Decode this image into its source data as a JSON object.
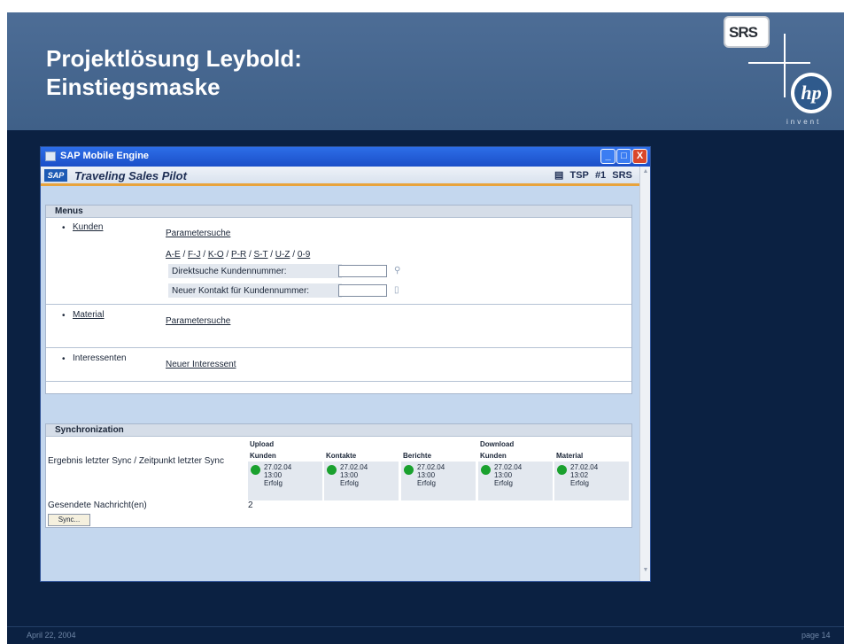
{
  "slide": {
    "title": "Projektlösung Leybold:\nEinstiegsmaske",
    "footer_date": "April 22, 2004",
    "footer_page": "page 14",
    "logo_srs": "SRS",
    "logo_hp": "hp",
    "logo_invent": "invent"
  },
  "window": {
    "title": "SAP Mobile Engine",
    "app_title": "Traveling Sales Pilot",
    "sap_logo": "SAP",
    "right_marker": "#1",
    "tsp_label": "TSP",
    "srs_label": "SRS",
    "controls": {
      "minimize": "_",
      "maximize": "□",
      "close": "X"
    }
  },
  "menus": {
    "heading": "Menus",
    "kunden": {
      "label": "Kunden",
      "parametersuche": "Parametersuche",
      "ranges": [
        "A-E",
        "F-J",
        "K-O",
        "P-R",
        "S-T",
        "U-Z",
        "0-9"
      ],
      "direktsuche_label": "Direktsuche Kundennummer:",
      "neuer_kontakt_label": "Neuer Kontakt für Kundennummer:"
    },
    "material": {
      "label": "Material",
      "parametersuche": "Parametersuche"
    },
    "interessenten": {
      "label": "Interessenten",
      "neuer": "Neuer Interessent"
    }
  },
  "sync": {
    "heading": "Synchronization",
    "upload_label": "Upload",
    "download_label": "Download",
    "row_label": "Ergebnis letzter Sync / Zeitpunkt letzter Sync",
    "columns": [
      {
        "name": "Kunden",
        "date": "27.02.04",
        "time": "13:00",
        "status": "Erfolg"
      },
      {
        "name": "Kontakte",
        "date": "27.02.04",
        "time": "13:00",
        "status": "Erfolg"
      },
      {
        "name": "Berichte",
        "date": "27.02.04",
        "time": "13:00",
        "status": "Erfolg"
      },
      {
        "name": "Kunden",
        "date": "27.02.04",
        "time": "13:00",
        "status": "Erfolg"
      },
      {
        "name": "Material",
        "date": "27.02.04",
        "time": "13:02",
        "status": "Erfolg"
      }
    ],
    "sent_label": "Gesendete Nachricht(en)",
    "sent_count": "2",
    "sync_button": "Sync..."
  },
  "colors": {
    "status_ok": "#1aa12e",
    "accent_orange": "#e8a33c",
    "slide_bg": "#0b2142"
  }
}
